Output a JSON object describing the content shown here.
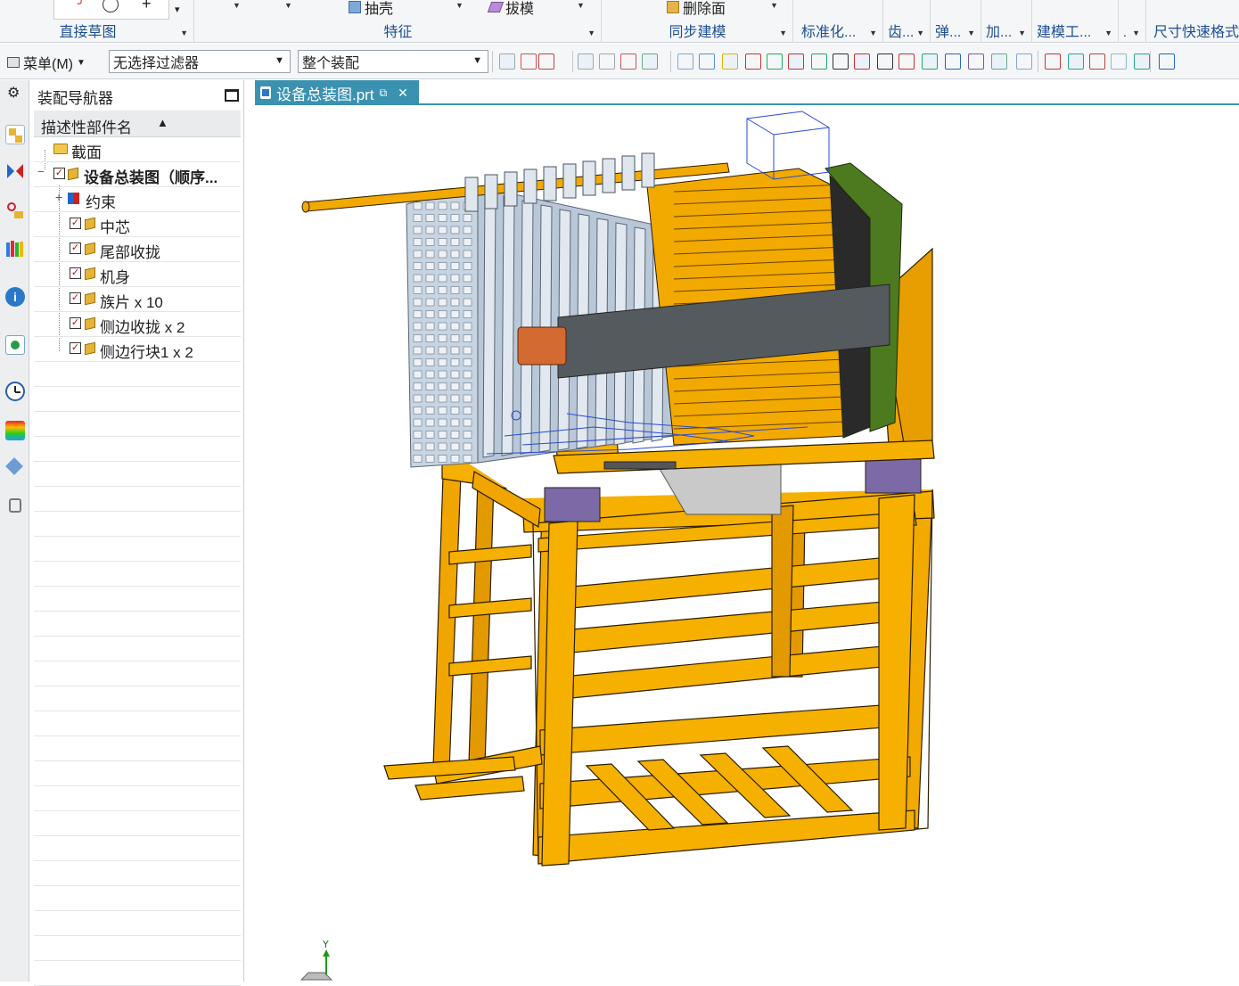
{
  "ribbon": {
    "groups": [
      {
        "label": "直接草图"
      },
      {
        "label": "特征"
      },
      {
        "label": "同步建模"
      },
      {
        "label": "标准化..."
      },
      {
        "label": "齿..."
      },
      {
        "label": "弹..."
      },
      {
        "label": "加..."
      },
      {
        "label": "建模工..."
      },
      {
        "label": "尺寸快速格式"
      }
    ],
    "buttons": {
      "shell": "抽壳",
      "draft": "拔模",
      "delete_face": "删除面"
    }
  },
  "toolbar": {
    "menu_label": "菜单(M)",
    "filter_value": "无选择过滤器",
    "scope_value": "整个装配"
  },
  "navigator": {
    "title": "装配导航器",
    "column_header": "描述性部件名",
    "rows": [
      {
        "label": "截面"
      },
      {
        "label": "设备总装图（顺序..."
      },
      {
        "label": "约束"
      },
      {
        "label": "中芯"
      },
      {
        "label": "尾部收拢"
      },
      {
        "label": "机身"
      },
      {
        "label": "族片 x 10"
      },
      {
        "label": "侧边收拢 x 2"
      },
      {
        "label": "侧边行块1 x 2"
      }
    ]
  },
  "document_tab": {
    "label": "设备总装图.prt"
  },
  "viewport": {
    "axis_label": "Y"
  },
  "colors": {
    "frame": "#f2a900",
    "accent": "#3a91b0",
    "plate": "#c7d4e2",
    "green": "#4d7a1f"
  }
}
